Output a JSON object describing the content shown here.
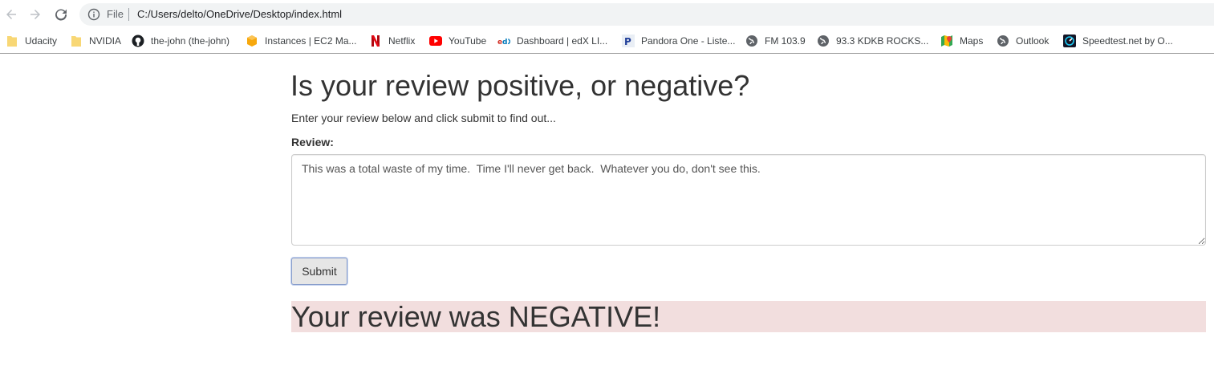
{
  "browser": {
    "omnibox": {
      "scheme_label": "File",
      "url": "C:/Users/delto/OneDrive/Desktop/index.html"
    },
    "bookmarks": [
      {
        "label": "Udacity",
        "icon": "folder-icon"
      },
      {
        "label": "NVIDIA",
        "icon": "folder-icon"
      },
      {
        "label": "the-john (the-john)",
        "icon": "github-icon"
      },
      {
        "label": "Instances | EC2 Ma...",
        "icon": "aws-cube-icon"
      },
      {
        "label": "Netflix",
        "icon": "netflix-icon"
      },
      {
        "label": "YouTube",
        "icon": "youtube-icon"
      },
      {
        "label": "Dashboard | edX LI...",
        "icon": "edx-icon"
      },
      {
        "label": "Pandora One - Liste...",
        "icon": "pandora-icon"
      },
      {
        "label": "FM 103.9",
        "icon": "globe-icon"
      },
      {
        "label": "93.3 KDKB ROCKS...",
        "icon": "globe-icon"
      },
      {
        "label": "Maps",
        "icon": "maps-icon"
      },
      {
        "label": "Outlook",
        "icon": "globe-icon"
      },
      {
        "label": "Speedtest.net by O...",
        "icon": "speedtest-icon"
      }
    ]
  },
  "page": {
    "title": "Is your review positive, or negative?",
    "intro": "Enter your review below and click submit to find out...",
    "review_label": "Review:",
    "review_value": "This was a total waste of my time.  Time I'll never get back.  Whatever you do, don't see this.",
    "submit_label": "Submit",
    "result_text": "Your review was NEGATIVE!"
  },
  "colors": {
    "result_background": "#f2dede",
    "omnibox_background": "#f1f3f4",
    "text": "#333333"
  }
}
